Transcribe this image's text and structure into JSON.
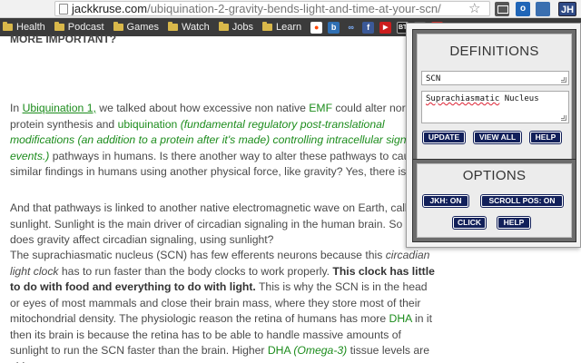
{
  "browser": {
    "url_host": "jackkruse.com",
    "url_path": "/ubiquination-2-gravity-bends-light-and-time-at-your-scn/",
    "extension_jh_label": "JH",
    "extension_outlook_label": "o"
  },
  "bookmarks": [
    {
      "label": "Health",
      "icon": "folder"
    },
    {
      "label": "Podcast",
      "icon": "folder"
    },
    {
      "label": "Games",
      "icon": "folder"
    },
    {
      "label": "Watch",
      "icon": "folder"
    },
    {
      "label": "Jobs",
      "icon": "folder"
    },
    {
      "label": "Learn",
      "icon": "folder"
    }
  ],
  "bookmark_icons": [
    {
      "name": "reddit-icon",
      "text": "",
      "color": "#ffffff"
    },
    {
      "name": "bookmark-b-icon",
      "text": "b",
      "color": "#2f6fb3"
    },
    {
      "name": "infinity-icon",
      "text": "∞",
      "color": "#3b3b3b"
    },
    {
      "name": "facebook-icon",
      "text": "f",
      "color": "#3b5998"
    },
    {
      "name": "youtube-icon",
      "text": "▶",
      "color": "#cc1d1d"
    },
    {
      "name": "bt-icon",
      "text": "BT",
      "color": "#222222"
    },
    {
      "name": "bookmark-dark-icon",
      "text": "",
      "color": "#5a5a5a"
    },
    {
      "name": "bookmark-red-icon",
      "text": "",
      "color": "#c8322d"
    }
  ],
  "article": {
    "heading": "MORE IMPORTANT?",
    "p1": {
      "t1": "In ",
      "link1": "Ubiquination 1,",
      "t2": " we talked about how excessive non native ",
      "emf": "EMF",
      "t3": " could alter normal protein synthesis and ",
      "ubiq": "ubiquination",
      "ital": "(fundamental regulatory post-translational modifications (an addition to a protein after it's made) controlling intracellular signaling events.)",
      "t4": " pathways in humans. Is there another way to alter these pathways to cause similar findings in humans using another physical force, like gravity? Yes, there is."
    },
    "p2": "And that pathways is linked to another native electromagnetic wave on Earth, called sunlight. Sunlight is the main driver of circadian signaling in the human brain. So how does gravity affect circadian signaling, using sunlight?",
    "p3": {
      "t1": "The suprachiasmatic nucleus (SCN) has few efferents neurons because this ",
      "ital": "circadian light clock",
      "t2": " has to run faster than the body clocks to work properly.   ",
      "bold": "This clock has little to do with food and everything to do with light.",
      "t3": "  This is why the SCN is in the head or eyes of most mammals and close their brain mass,  where they store most of their mitochondrial density. The physiologic reason the retina of humans has more ",
      "dha1": "DHA",
      "t4": " in it then its brain is because the retina has to be able to handle massive amounts of sunlight to run the SCN faster than the brain.  Higher ",
      "dha2": "DHA",
      "omega": "(Omega-3)",
      "t5": " tissue levels are able to"
    }
  },
  "popup": {
    "definitions_title": "DEFINITIONS",
    "term_value": "SCN",
    "definition_word1": "Suprachiasmatic",
    "definition_word2": " Nucleus",
    "update_label": "UPDATE",
    "view_all_label": "VIEW ALL",
    "help_label_1": "HELP",
    "options_title": "OPTIONS",
    "jkh_label": "JKH: ON",
    "scroll_pos_label": "SCROLL POS: ON",
    "click_label": "CLICK",
    "help_label_2": "HELP"
  }
}
